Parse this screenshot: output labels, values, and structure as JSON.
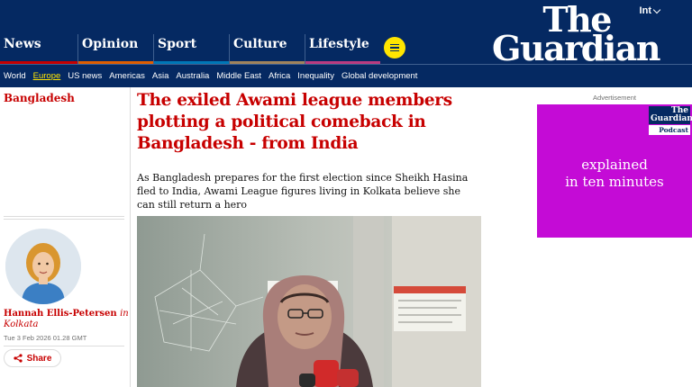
{
  "header": {
    "edition": "Int",
    "logo_line1": "The",
    "logo_line2": "Guardian",
    "pillars": [
      {
        "label": "News",
        "color": "#c70000"
      },
      {
        "label": "Opinion",
        "color": "#e05e00"
      },
      {
        "label": "Sport",
        "color": "#0077b6"
      },
      {
        "label": "Culture",
        "color": "#a1845c"
      },
      {
        "label": "Lifestyle",
        "color": "#bb3b80"
      }
    ],
    "menu_icon": "hamburger-menu-icon",
    "subnav": [
      "World",
      "Europe",
      "US news",
      "Americas",
      "Asia",
      "Australia",
      "Middle East",
      "Africa",
      "Inequality",
      "Global development"
    ],
    "subnav_active": "Europe"
  },
  "article": {
    "section": "Bangladesh",
    "headline": "The exiled Awami league members plotting a political comeback in Bangladesh - from India",
    "standfirst": "As Bangladesh prepares for the first election since Sheikh Hasina fled to India, Awami League figures living in Kolkata believe she can still return a hero",
    "author_name": "Hannah Ellis-Petersen",
    "author_in": "in",
    "author_location": "Kolkata",
    "date": "Tue 3 Feb 2026 01.28 GMT",
    "share_label": "Share"
  },
  "ad": {
    "label": "Advertisement",
    "logo_line1": "The Guardian",
    "logo_line2": "Podcast",
    "text_line1": "explained",
    "text_line2": "in ten minutes"
  },
  "colors": {
    "brand_blue": "#052962",
    "headline_red": "#c70000",
    "highlight_yellow": "#ffe500",
    "ad_magenta": "#c40bd6"
  }
}
